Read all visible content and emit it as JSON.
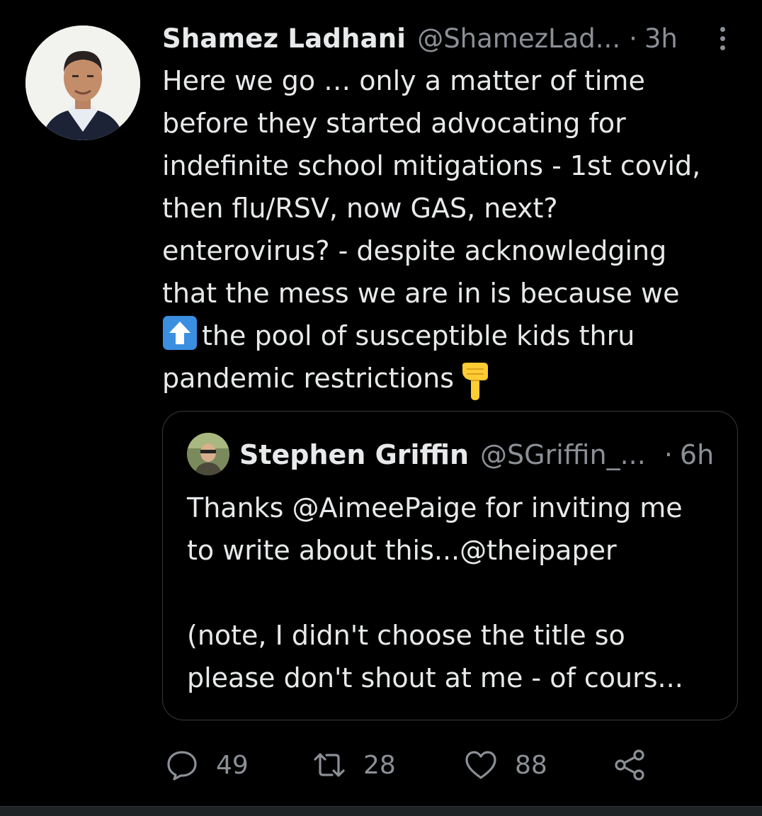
{
  "tweet": {
    "author_name": "Shamez Ladhani",
    "author_handle": "@ShamezLad...",
    "separator": "·",
    "time": "3h",
    "text_line1": "Here we go … only a matter of time\nbefore they started advocating for\nindefinite school mitigations - 1st covid,\nthen flu/RSV, now GAS, next?\nenterovirus? - despite acknowledging\nthat the mess we are in is because we\n",
    "text_line2": "the pool of susceptible kids thru\npandemic restrictions",
    "emoji_up": "up-arrow-emoji",
    "emoji_point": "backhand-index-pointing-down-emoji",
    "more_icon": "more-vertical-icon"
  },
  "quoted_tweet": {
    "author_name": "Stephen Griffin",
    "author_handle": "@SGriffin_...",
    "separator": "·",
    "time": "6h",
    "text": "Thanks @AimeePaige for inviting me\nto write about this...@theipaper\n\n(note, I didn't choose the title so\nplease don't shout at me - of cours..."
  },
  "actions": {
    "reply_count": "49",
    "retweet_count": "28",
    "like_count": "88"
  },
  "colors": {
    "background": "#000000",
    "text": "#e7e9ea",
    "muted": "#8b9096",
    "border": "#35393d",
    "emoji_blue": "#3b8fe0",
    "emoji_yellow": "#ffcc33"
  }
}
